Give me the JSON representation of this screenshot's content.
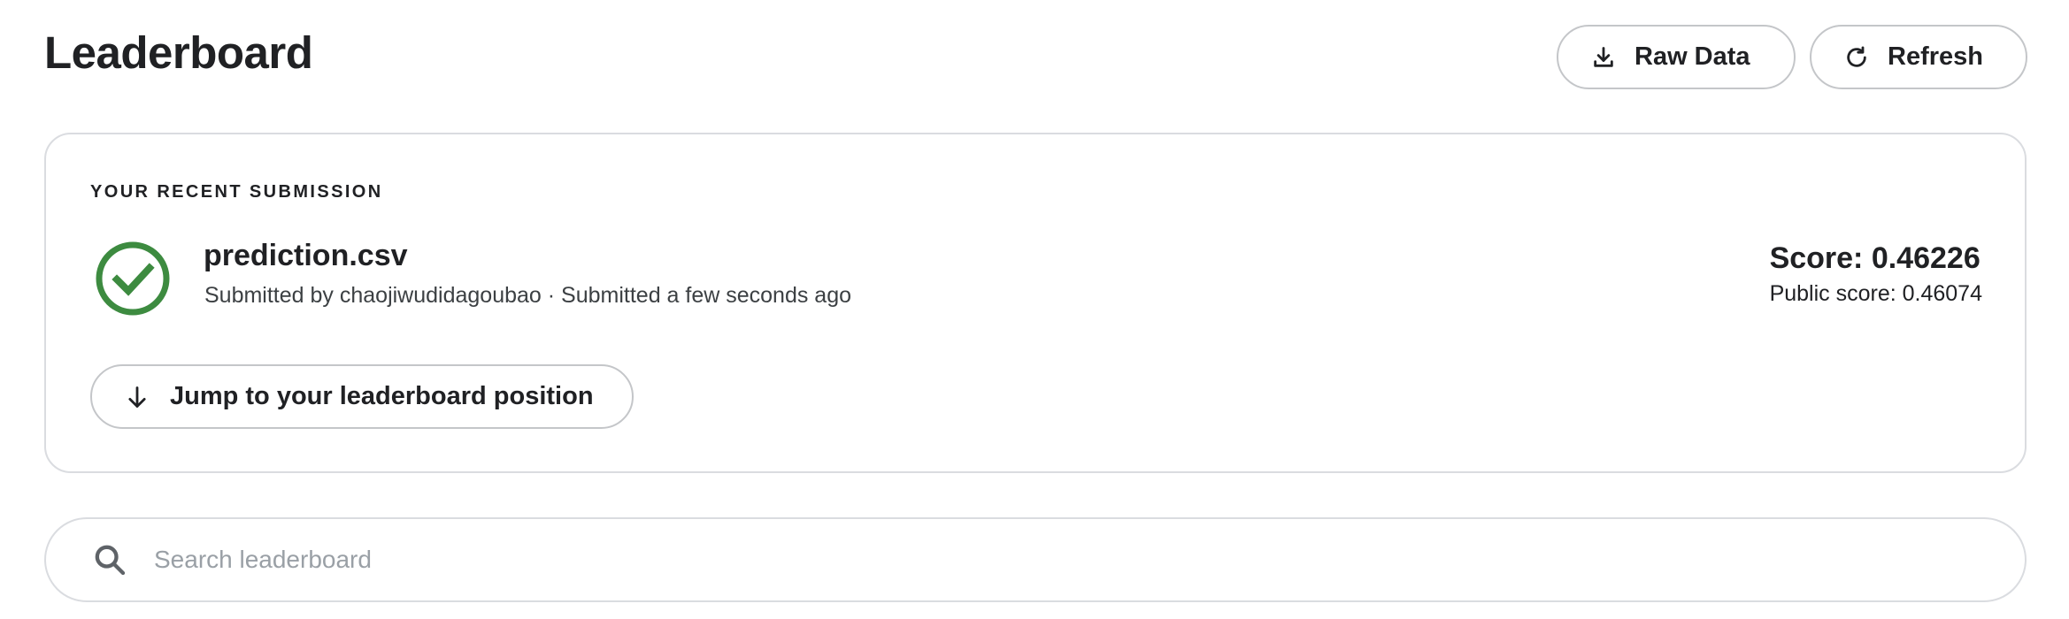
{
  "header": {
    "title": "Leaderboard",
    "raw_data_label": "Raw Data",
    "refresh_label": "Refresh"
  },
  "submission": {
    "heading": "YOUR RECENT SUBMISSION",
    "status_icon": "check-circle-icon",
    "status_color": "#3d8b40",
    "file_name": "prediction.csv",
    "submitted_line": "Submitted by chaojiwudidagoubao · Submitted a few seconds ago",
    "score": "Score: 0.46226",
    "public_score": "Public score: 0.46074",
    "jump_label": "Jump to your leaderboard position"
  },
  "search": {
    "placeholder": "Search leaderboard",
    "value": ""
  },
  "icons": {
    "download": "download-icon",
    "refresh": "refresh-icon",
    "arrow_down": "arrow-down-icon",
    "search": "search-icon"
  }
}
